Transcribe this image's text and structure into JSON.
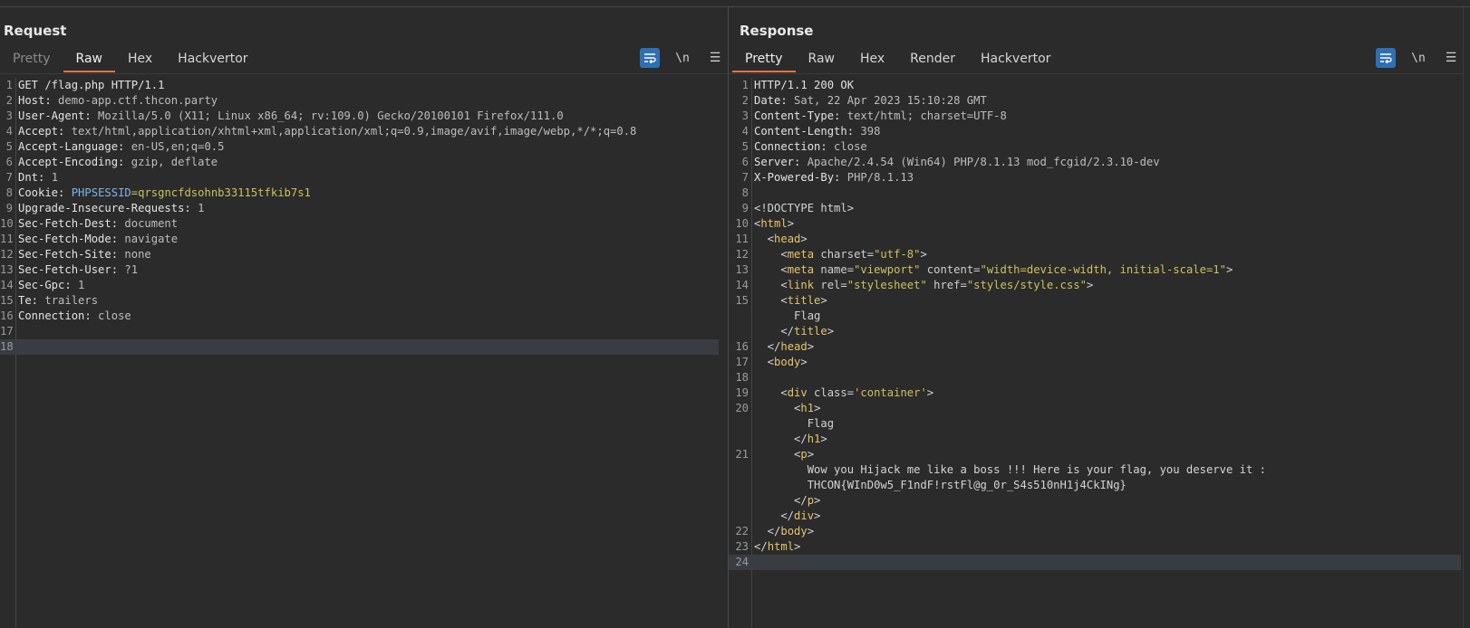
{
  "request": {
    "title": "Request",
    "tabs": [
      "Pretty",
      "Raw",
      "Hex",
      "Hackvertor"
    ],
    "active_tab": "Raw",
    "lines": [
      {
        "n": "1",
        "k": "GET /flag.php HTTP/1.1",
        "v": ""
      },
      {
        "n": "2",
        "k": "Host:",
        "v": " demo-app.ctf.thcon.party"
      },
      {
        "n": "3",
        "k": "User-Agent:",
        "v": " Mozilla/5.0 (X11; Linux x86_64; rv:109.0) Gecko/20100101 Firefox/111.0"
      },
      {
        "n": "4",
        "k": "Accept:",
        "v": " text/html,application/xhtml+xml,application/xml;q=0.9,image/avif,image/webp,*/*;q=0.8"
      },
      {
        "n": "5",
        "k": "Accept-Language:",
        "v": " en-US,en;q=0.5"
      },
      {
        "n": "6",
        "k": "Accept-Encoding:",
        "v": " gzip, deflate"
      },
      {
        "n": "7",
        "k": "Dnt:",
        "v": " 1"
      },
      {
        "n": "8",
        "k": "Cookie:",
        "v": " ",
        "ck": "PHPSESSID",
        "cv": "=qrsgncfdsohnb33115tfkib7s1"
      },
      {
        "n": "9",
        "k": "Upgrade-Insecure-Requests:",
        "v": " 1"
      },
      {
        "n": "10",
        "k": "Sec-Fetch-Dest:",
        "v": " document"
      },
      {
        "n": "11",
        "k": "Sec-Fetch-Mode:",
        "v": " navigate"
      },
      {
        "n": "12",
        "k": "Sec-Fetch-Site:",
        "v": " none"
      },
      {
        "n": "13",
        "k": "Sec-Fetch-User:",
        "v": " ?1"
      },
      {
        "n": "14",
        "k": "Sec-Gpc:",
        "v": " 1"
      },
      {
        "n": "15",
        "k": "Te:",
        "v": " trailers"
      },
      {
        "n": "16",
        "k": "Connection:",
        "v": " close"
      },
      {
        "n": "17",
        "k": "",
        "v": ""
      },
      {
        "n": "18",
        "k": "",
        "v": "",
        "cur": true
      }
    ]
  },
  "response": {
    "title": "Response",
    "tabs": [
      "Pretty",
      "Raw",
      "Hex",
      "Render",
      "Hackvertor"
    ],
    "active_tab": "Pretty",
    "lines": [
      {
        "n": "1",
        "parts": [
          [
            "hk",
            "HTTP/1.1 200 OK"
          ]
        ]
      },
      {
        "n": "2",
        "parts": [
          [
            "hk",
            "Date:"
          ],
          [
            "hv",
            " Sat, 22 Apr 2023 15:10:28 GMT"
          ]
        ]
      },
      {
        "n": "3",
        "parts": [
          [
            "hk",
            "Content-Type:"
          ],
          [
            "hv",
            " text/html; charset=UTF-8"
          ]
        ]
      },
      {
        "n": "4",
        "parts": [
          [
            "hk",
            "Content-Length:"
          ],
          [
            "hv",
            " 398"
          ]
        ]
      },
      {
        "n": "5",
        "parts": [
          [
            "hk",
            "Connection:"
          ],
          [
            "hv",
            " close"
          ]
        ]
      },
      {
        "n": "6",
        "parts": [
          [
            "hk",
            "Server:"
          ],
          [
            "hv",
            " Apache/2.4.54 (Win64) PHP/8.1.13 mod_fcgid/2.3.10-dev"
          ]
        ]
      },
      {
        "n": "7",
        "parts": [
          [
            "hk",
            "X-Powered-By:"
          ],
          [
            "hv",
            " PHP/8.1.13"
          ]
        ]
      },
      {
        "n": "8",
        "parts": []
      },
      {
        "n": "9",
        "parts": [
          [
            "pl",
            "<!DOCTYPE html>"
          ]
        ]
      },
      {
        "n": "10",
        "parts": [
          [
            "pl",
            "<"
          ],
          [
            "tg",
            "html"
          ],
          [
            "pl",
            ">"
          ]
        ]
      },
      {
        "n": "11",
        "parts": [
          [
            "pl",
            "  <"
          ],
          [
            "tg",
            "head"
          ],
          [
            "pl",
            ">"
          ]
        ]
      },
      {
        "n": "12",
        "parts": [
          [
            "pl",
            "    <"
          ],
          [
            "tg",
            "meta"
          ],
          [
            "an",
            " charset="
          ],
          [
            "av",
            "\"utf-8\""
          ],
          [
            "pl",
            ">"
          ]
        ]
      },
      {
        "n": "13",
        "parts": [
          [
            "pl",
            "    <"
          ],
          [
            "tg",
            "meta"
          ],
          [
            "an",
            " name="
          ],
          [
            "av",
            "\"viewport\""
          ],
          [
            "an",
            " content="
          ],
          [
            "av",
            "\"width=device-width, initial-scale=1\""
          ],
          [
            "pl",
            ">"
          ]
        ]
      },
      {
        "n": "14",
        "parts": [
          [
            "pl",
            "    <"
          ],
          [
            "tg",
            "link"
          ],
          [
            "an",
            " rel="
          ],
          [
            "av",
            "\"stylesheet\""
          ],
          [
            "an",
            " href="
          ],
          [
            "av",
            "\"styles/style.css\""
          ],
          [
            "pl",
            ">"
          ]
        ]
      },
      {
        "n": "15",
        "parts": [
          [
            "pl",
            "    <"
          ],
          [
            "tg",
            "title"
          ],
          [
            "pl",
            ">"
          ]
        ]
      },
      {
        "n": "",
        "parts": [
          [
            "pl",
            "      Flag"
          ]
        ]
      },
      {
        "n": "",
        "parts": [
          [
            "pl",
            "    </"
          ],
          [
            "tg",
            "title"
          ],
          [
            "pl",
            ">"
          ]
        ]
      },
      {
        "n": "16",
        "parts": [
          [
            "pl",
            "  </"
          ],
          [
            "tg",
            "head"
          ],
          [
            "pl",
            ">"
          ]
        ]
      },
      {
        "n": "17",
        "parts": [
          [
            "pl",
            "  <"
          ],
          [
            "tg",
            "body"
          ],
          [
            "pl",
            ">"
          ]
        ]
      },
      {
        "n": "18",
        "parts": []
      },
      {
        "n": "19",
        "parts": [
          [
            "pl",
            "    <"
          ],
          [
            "tg",
            "div"
          ],
          [
            "an",
            " class="
          ],
          [
            "av",
            "'container'"
          ],
          [
            "pl",
            ">"
          ]
        ]
      },
      {
        "n": "20",
        "parts": [
          [
            "pl",
            "      <"
          ],
          [
            "tg",
            "h1"
          ],
          [
            "pl",
            ">"
          ]
        ]
      },
      {
        "n": "",
        "parts": [
          [
            "pl",
            "        Flag"
          ]
        ]
      },
      {
        "n": "",
        "parts": [
          [
            "pl",
            "      </"
          ],
          [
            "tg",
            "h1"
          ],
          [
            "pl",
            ">"
          ]
        ]
      },
      {
        "n": "21",
        "parts": [
          [
            "pl",
            "      <"
          ],
          [
            "tg",
            "p"
          ],
          [
            "pl",
            ">"
          ]
        ]
      },
      {
        "n": "",
        "parts": [
          [
            "pl",
            "        Wow you Hijack me like a boss !!! Here is your flag, you deserve it :"
          ]
        ]
      },
      {
        "n": "",
        "parts": [
          [
            "pl",
            "        THCON{WInD0w5_F1ndF!rstFl@g_0r_S4s510nH1j4CkINg}"
          ]
        ]
      },
      {
        "n": "",
        "parts": [
          [
            "pl",
            "      </"
          ],
          [
            "tg",
            "p"
          ],
          [
            "pl",
            ">"
          ]
        ]
      },
      {
        "n": "",
        "parts": [
          [
            "pl",
            "    </"
          ],
          [
            "tg",
            "div"
          ],
          [
            "pl",
            ">"
          ]
        ]
      },
      {
        "n": "22",
        "parts": [
          [
            "pl",
            "  </"
          ],
          [
            "tg",
            "body"
          ],
          [
            "pl",
            ">"
          ]
        ]
      },
      {
        "n": "23",
        "parts": [
          [
            "pl",
            "</"
          ],
          [
            "tg",
            "html"
          ],
          [
            "pl",
            ">"
          ]
        ]
      },
      {
        "n": "24",
        "parts": [],
        "cur": true
      }
    ]
  },
  "toolbar": {
    "wrap_icon": "wrap-icon",
    "newline_label": "\\n",
    "menu_label": "☰"
  },
  "colors": {
    "accent": "#e8743b",
    "selected_blue": "#2f6fb3",
    "tag": "#e7c46b",
    "attr_value": "#c9c35c",
    "cookie_name": "#7eb5e8"
  }
}
